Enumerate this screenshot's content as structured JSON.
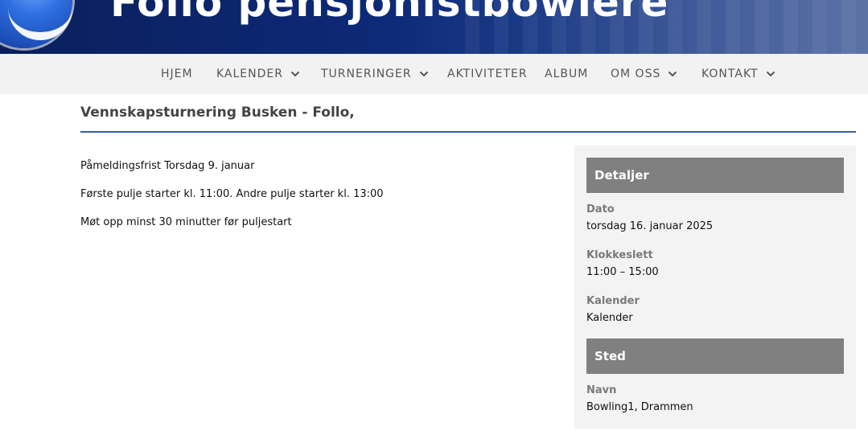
{
  "header": {
    "site_title": "Follo pensjonistbowlere"
  },
  "nav": {
    "items": [
      {
        "label": "HJEM",
        "has_dropdown": false
      },
      {
        "label": "KALENDER",
        "has_dropdown": true
      },
      {
        "label": "TURNERINGER",
        "has_dropdown": true
      },
      {
        "label": "AKTIVITETER",
        "has_dropdown": false
      },
      {
        "label": "ALBUM",
        "has_dropdown": false
      },
      {
        "label": "OM OSS",
        "has_dropdown": true
      },
      {
        "label": "KONTAKT",
        "has_dropdown": true
      }
    ]
  },
  "page": {
    "title": "Vennskapsturnering Busken - Follo,",
    "paragraphs": [
      "Påmeldingsfrist Torsdag 9. januar",
      "Første pulje starter kl. 11:00. Andre pulje starter kl. 13:00",
      "Møt opp minst 30 minutter før puljestart"
    ]
  },
  "sidebar": {
    "details_heading": "Detaljer",
    "fields": [
      {
        "label": "Dato",
        "value": "torsdag 16. januar 2025"
      },
      {
        "label": "Klokkeslett",
        "value": "11:00 – 15:00"
      },
      {
        "label": "Kalender",
        "value": "Kalender"
      }
    ],
    "venue_heading": "Sted",
    "venue_fields": [
      {
        "label": "Navn",
        "value": "Bowling1, Drammen"
      }
    ]
  },
  "colors": {
    "banner": "#0d2a78",
    "nav_bg": "#f2f2f2",
    "accent_rule": "#3a5ca8",
    "section_head": "#808080",
    "sidebar_bg": "#f3f3f3"
  }
}
